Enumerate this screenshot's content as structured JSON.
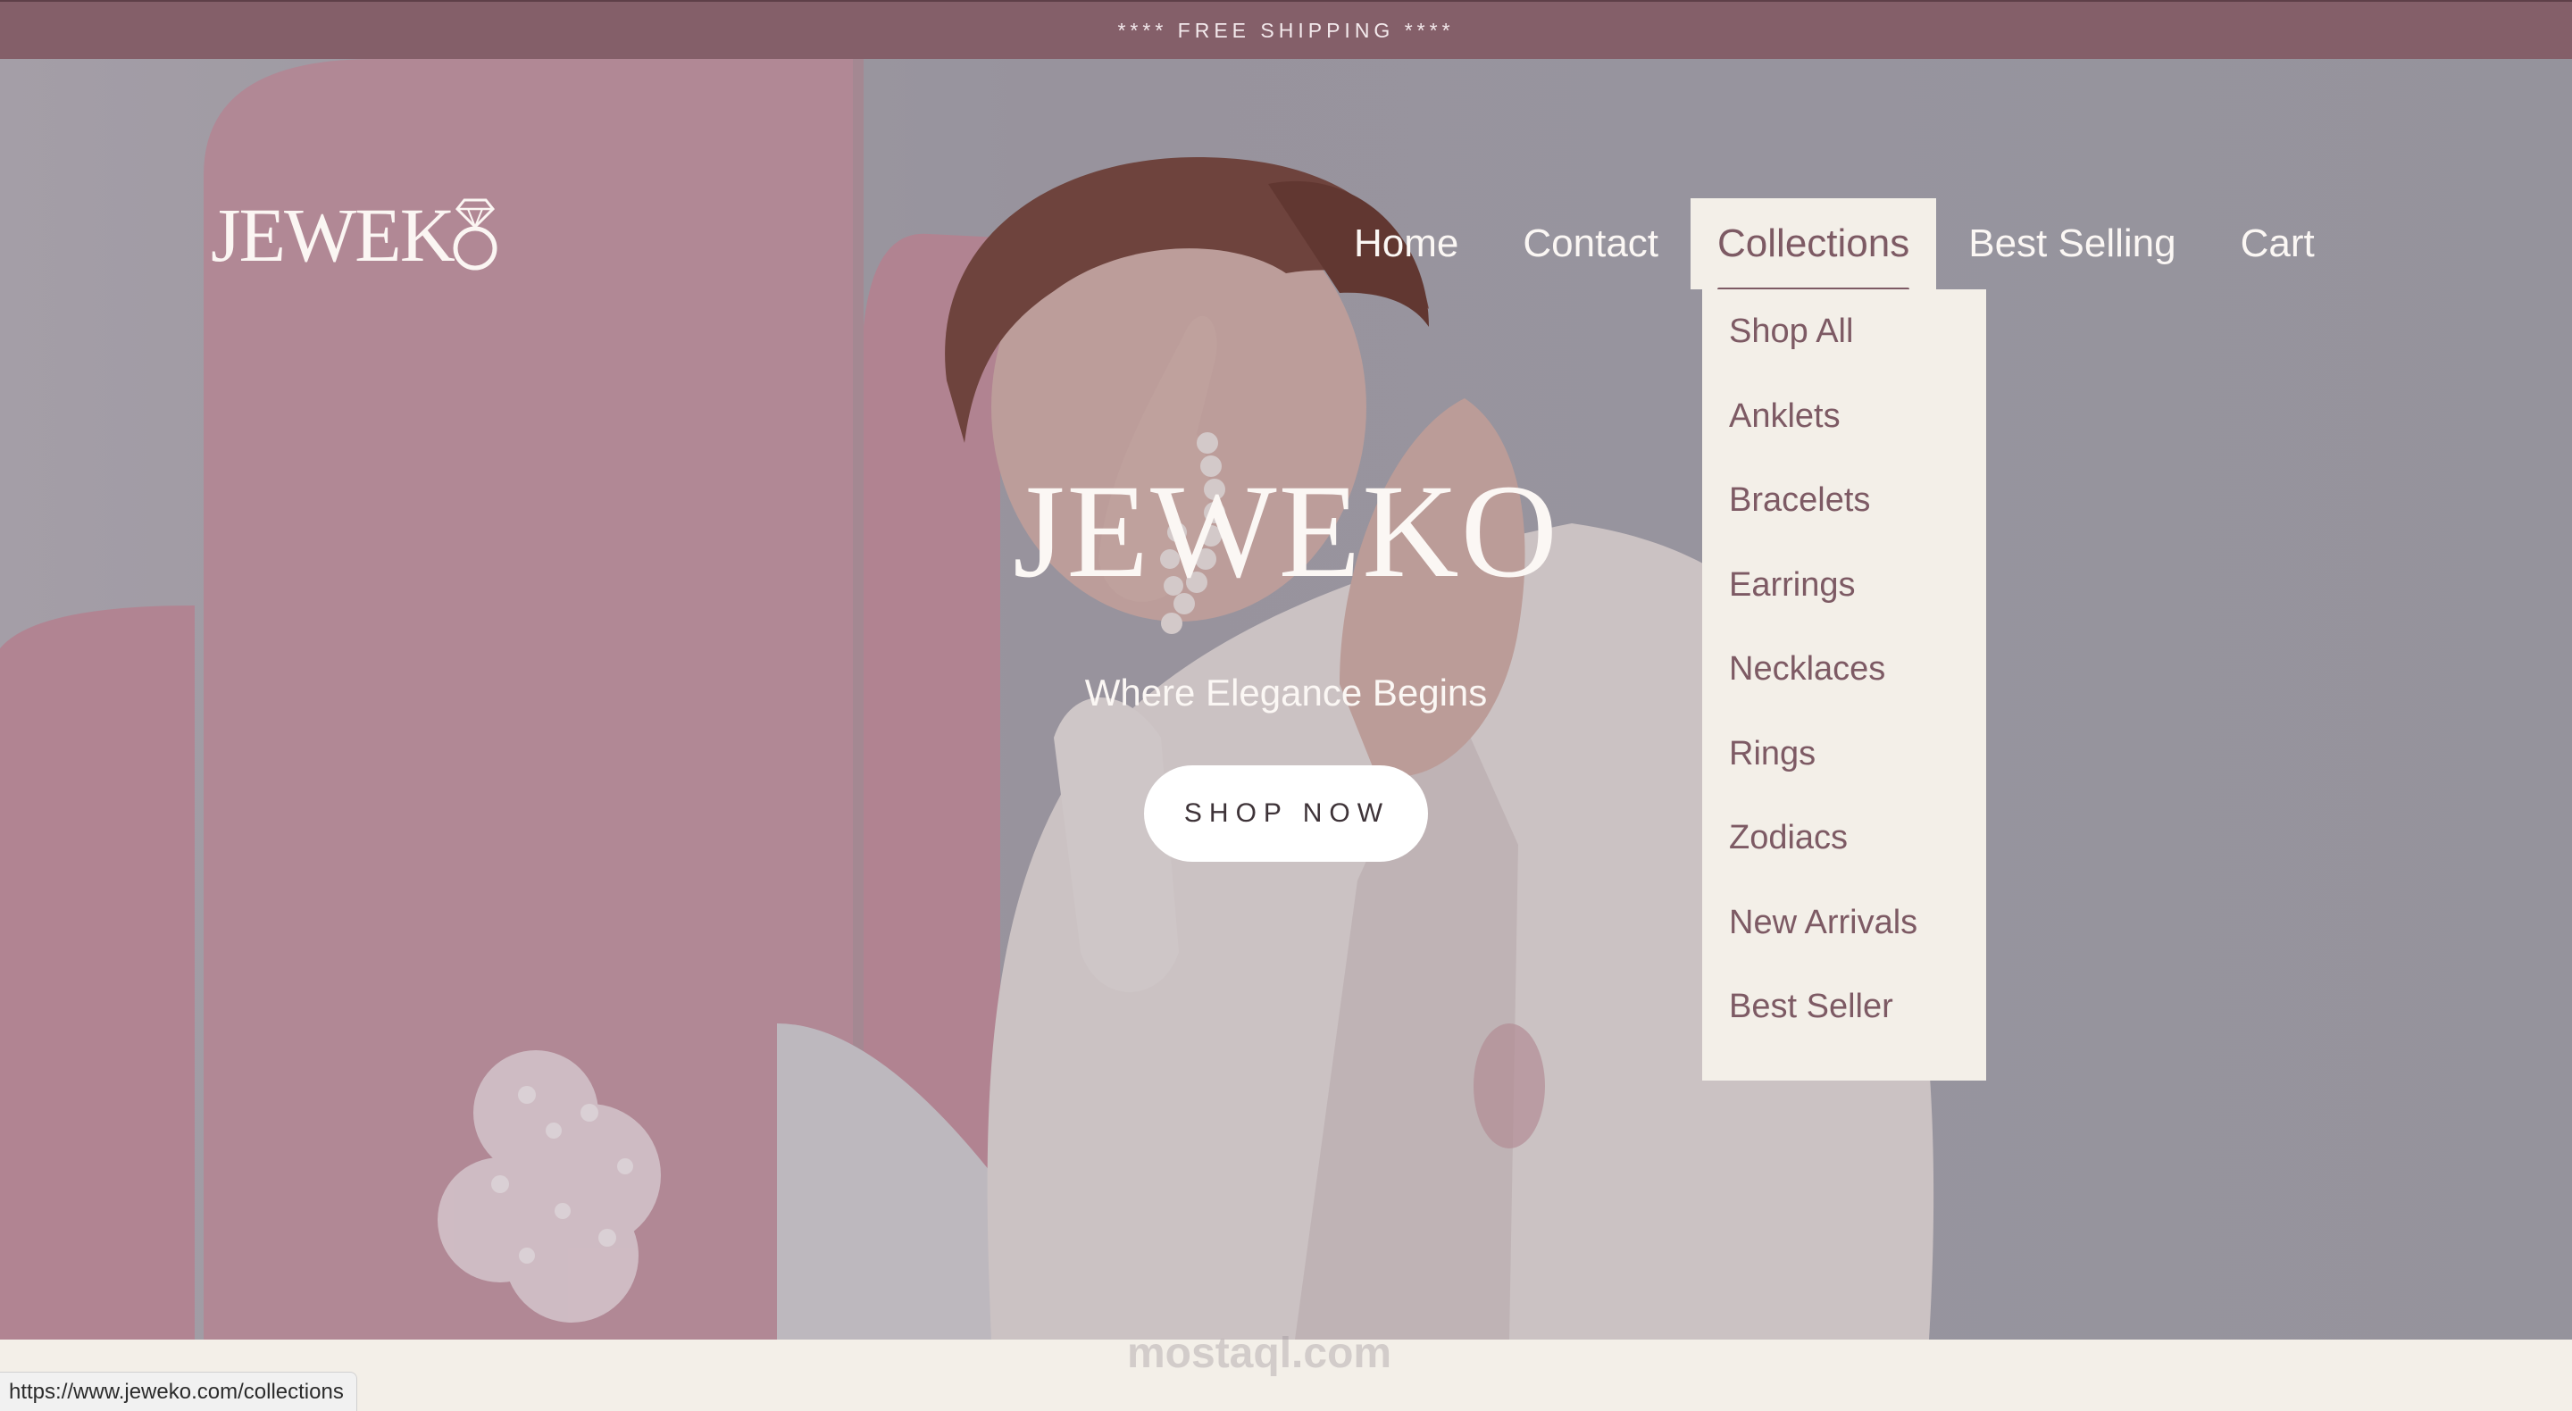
{
  "announcement": "**** FREE SHIPPING ****",
  "brand": {
    "logo_text": "JEWEK",
    "hero_title": "JEWEKO",
    "tagline": "Where Elegance Begins",
    "logo_icon": "diamond-ring-icon"
  },
  "nav": {
    "items": [
      {
        "label": "Home"
      },
      {
        "label": "Contact"
      },
      {
        "label": "Collections",
        "active": true
      },
      {
        "label": "Best Selling"
      },
      {
        "label": "Cart"
      }
    ]
  },
  "dropdown": {
    "items": [
      {
        "label": "Shop All"
      },
      {
        "label": "Anklets"
      },
      {
        "label": "Bracelets"
      },
      {
        "label": "Earrings"
      },
      {
        "label": "Necklaces"
      },
      {
        "label": "Rings"
      },
      {
        "label": "Zodiacs"
      },
      {
        "label": "New Arrivals"
      },
      {
        "label": "Best Seller"
      }
    ]
  },
  "cta": {
    "label": "SHOP NOW"
  },
  "watermark": "mostaql.com",
  "status_url": "https://www.jeweko.com/collections",
  "colors": {
    "accent": "#845f69",
    "menu_text": "#7d5a64",
    "menu_bg": "#f3efe8",
    "button_bg": "#ffffff"
  }
}
